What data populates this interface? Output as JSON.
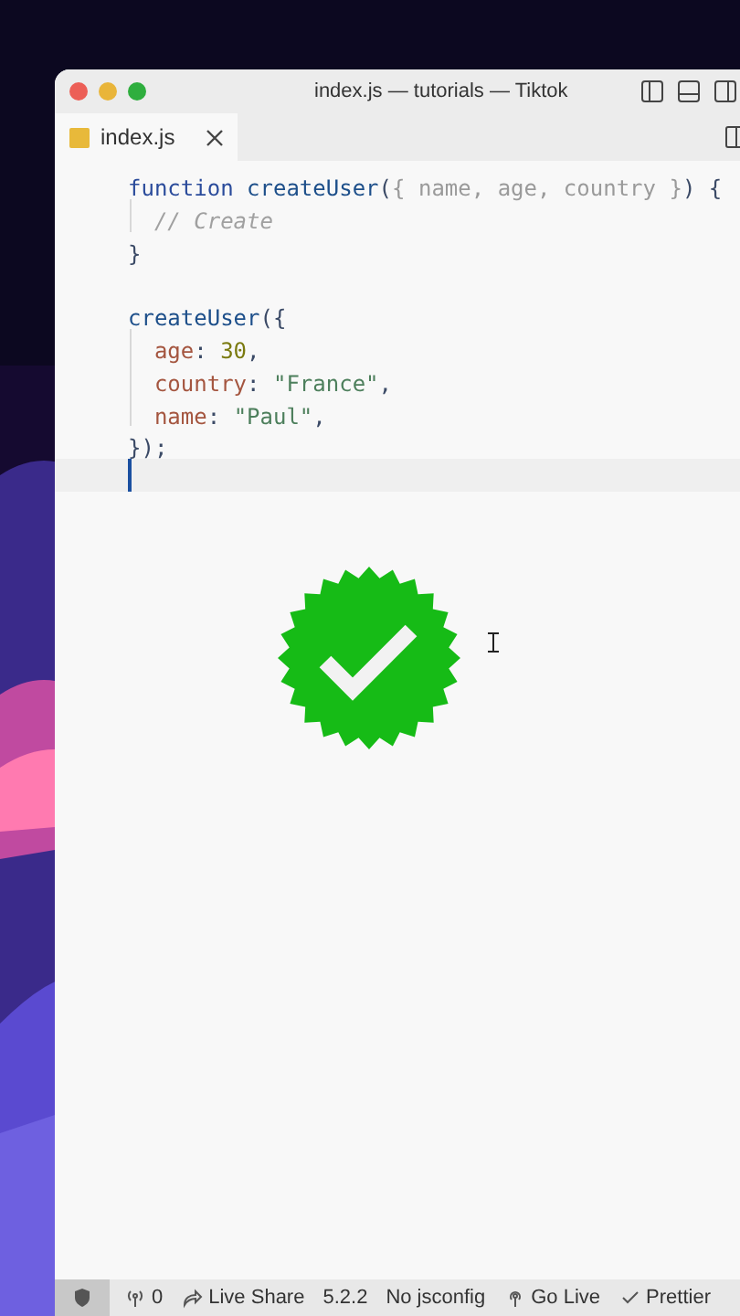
{
  "window": {
    "title": "index.js — tutorials — Tiktok"
  },
  "tabs": [
    {
      "label": "index.js",
      "selected": true
    }
  ],
  "editor": {
    "lines": [
      {
        "current": false,
        "tokens": [
          {
            "text": "function ",
            "kind": "keyword"
          },
          {
            "text": "createUser",
            "kind": "fn"
          },
          {
            "text": "(",
            "kind": "punct"
          },
          {
            "text": "{ name, age, country }",
            "kind": "param"
          },
          {
            "text": ") {",
            "kind": "punct"
          }
        ]
      },
      {
        "current": false,
        "tokens": [
          {
            "text": "  // Create",
            "kind": "comment"
          }
        ]
      },
      {
        "current": false,
        "tokens": [
          {
            "text": "}",
            "kind": "punct"
          }
        ]
      },
      {
        "current": false
      },
      {
        "current": false,
        "tokens": [
          {
            "text": "createUser",
            "kind": "fn"
          },
          {
            "text": "({",
            "kind": "punct"
          }
        ]
      },
      {
        "current": false,
        "tokens": [
          {
            "text": "  age",
            "kind": "prop"
          },
          {
            "text": ": ",
            "kind": "punct"
          },
          {
            "text": "30",
            "kind": "number"
          },
          {
            "text": ",",
            "kind": "punct"
          }
        ]
      },
      {
        "current": false,
        "tokens": [
          {
            "text": "  country",
            "kind": "prop"
          },
          {
            "text": ": ",
            "kind": "punct"
          },
          {
            "text": "\"France\"",
            "kind": "string"
          },
          {
            "text": ",",
            "kind": "punct"
          }
        ]
      },
      {
        "current": false,
        "tokens": [
          {
            "text": "  name",
            "kind": "prop"
          },
          {
            "text": ": ",
            "kind": "punct"
          },
          {
            "text": "\"Paul\"",
            "kind": "string"
          },
          {
            "text": ",",
            "kind": "punct"
          }
        ]
      },
      {
        "current": false,
        "tokens": [
          {
            "text": "});",
            "kind": "punct"
          }
        ]
      },
      {
        "current": true
      }
    ]
  },
  "status_bar": [
    {
      "kind": "shield"
    },
    {
      "kind": "broadcast",
      "label": "0"
    },
    {
      "kind": "share",
      "label": "Live Share"
    },
    {
      "kind": "text",
      "label": "5.2.2"
    },
    {
      "kind": "text",
      "label": "No jsconfig"
    },
    {
      "kind": "live",
      "label": "Go Live"
    },
    {
      "kind": "check",
      "label": "Prettier"
    }
  ]
}
